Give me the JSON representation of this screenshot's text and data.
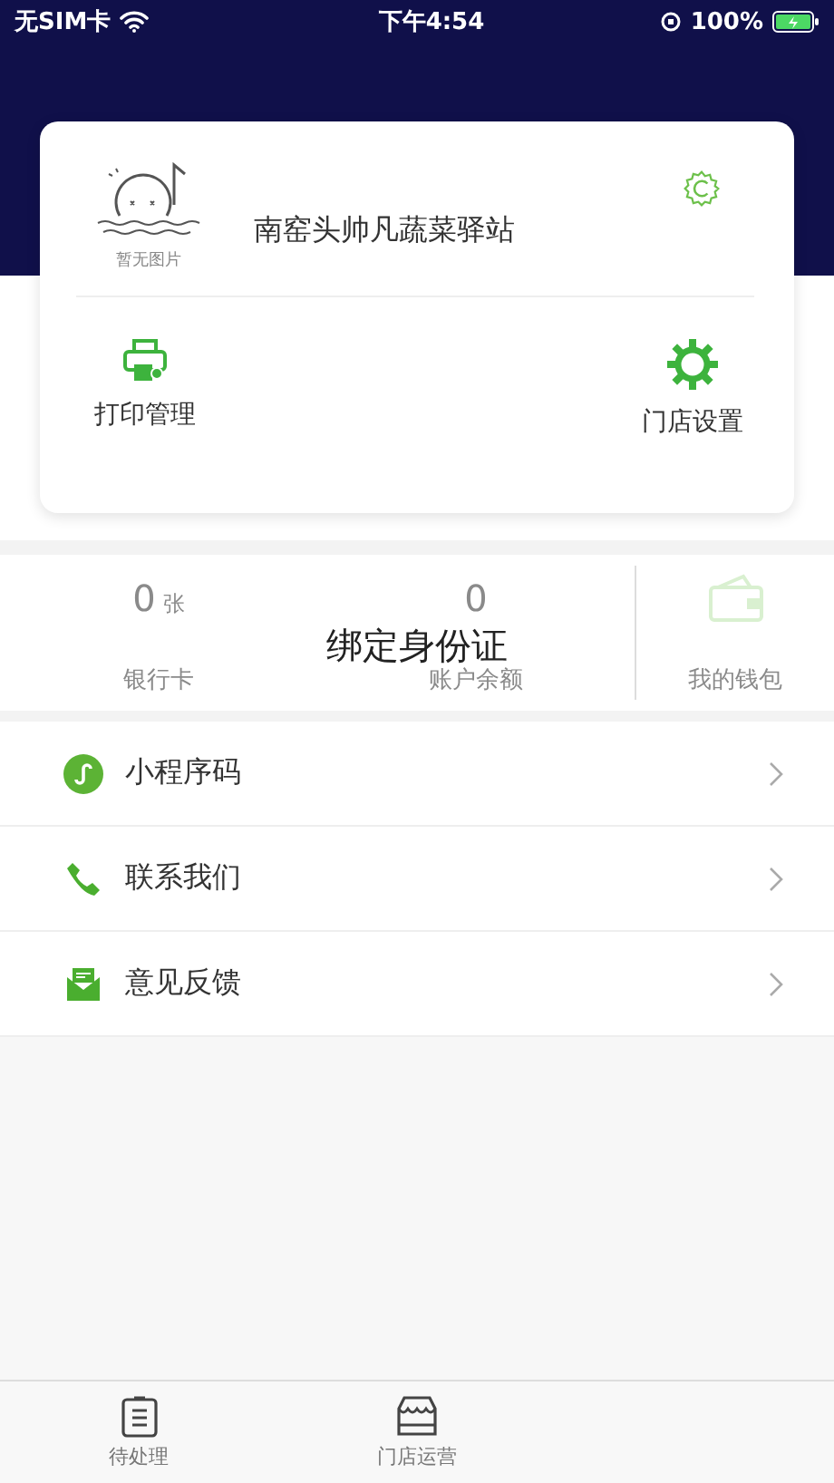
{
  "status_bar": {
    "carrier": "无SIM卡",
    "time": "下午4:54",
    "battery": "100%"
  },
  "store_card": {
    "placeholder_caption": "暂无图片",
    "store_name": "南窑头帅凡蔬菜驿站",
    "actions": [
      {
        "kind": "printer",
        "label": "打印管理"
      },
      {
        "kind": "gear",
        "label": "门店设置"
      }
    ]
  },
  "wallet": {
    "overlay_text": "绑定身份证",
    "stats": [
      {
        "value": "0",
        "unit": "张",
        "label": "银行卡"
      },
      {
        "value": "0",
        "label": "账户余额"
      }
    ],
    "wallet_label": "我的钱包"
  },
  "menu": [
    {
      "kind": "miniprogram",
      "label": "小程序码"
    },
    {
      "kind": "phone",
      "label": "联系我们"
    },
    {
      "kind": "feedback",
      "label": "意见反馈"
    }
  ],
  "tab_bar": [
    {
      "kind": "list",
      "label": "待处理"
    },
    {
      "kind": "store",
      "label": "门店运营"
    }
  ]
}
